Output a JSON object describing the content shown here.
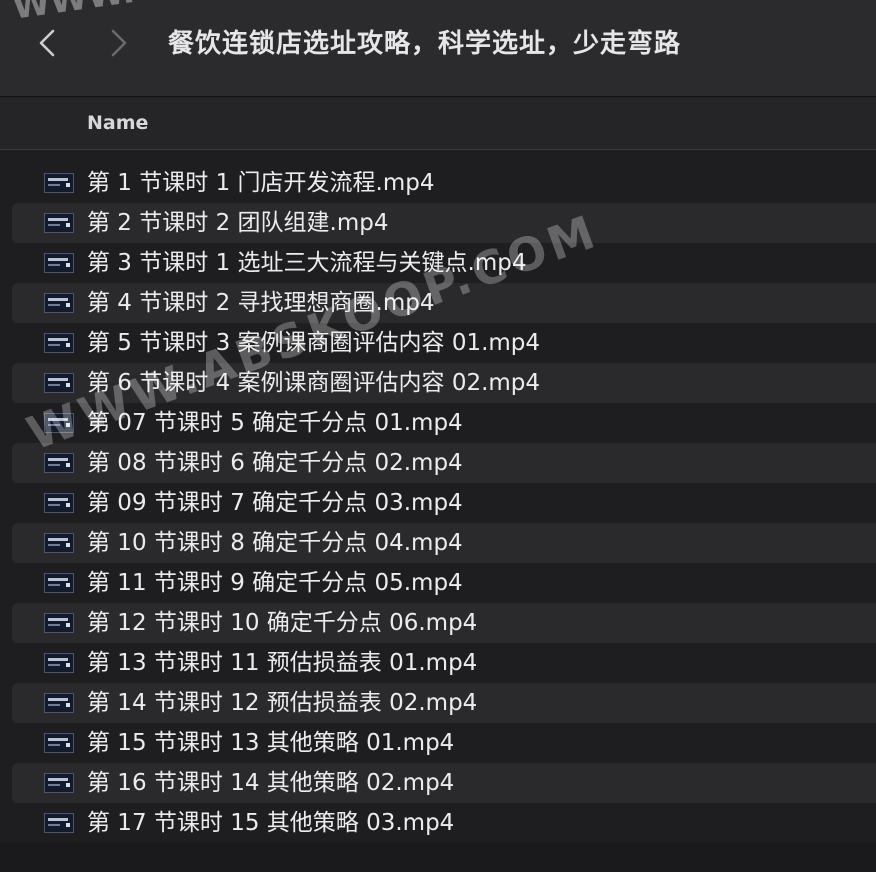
{
  "window": {
    "title": "餐饮连锁店选址攻略，科学选址，少走弯路",
    "back_icon": "chevron-left-icon",
    "forward_icon": "chevron-right-icon"
  },
  "header": {
    "name_label": "Name"
  },
  "files": [
    {
      "name": "第 1 节课时 1 门店开发流程.mp4"
    },
    {
      "name": "第 2 节课时 2 团队组建.mp4"
    },
    {
      "name": "第 3 节课时 1 选址三大流程与关键点.mp4"
    },
    {
      "name": "第 4 节课时 2 寻找理想商圈.mp4"
    },
    {
      "name": "第 5 节课时 3 案例课商圈评估内容 01.mp4"
    },
    {
      "name": "第 6 节课时 4 案例课商圈评估内容 02.mp4"
    },
    {
      "name": "第 07 节课时 5 确定千分点 01.mp4"
    },
    {
      "name": "第 08 节课时 6 确定千分点 02.mp4"
    },
    {
      "name": "第 09 节课时 7 确定千分点 03.mp4"
    },
    {
      "name": "第 10 节课时 8 确定千分点 04.mp4"
    },
    {
      "name": "第 11 节课时 9 确定千分点 05.mp4"
    },
    {
      "name": "第 12 节课时 10 确定千分点 06.mp4"
    },
    {
      "name": "第 13 节课时 11 预估损益表 01.mp4"
    },
    {
      "name": "第 14 节课时 12 预估损益表 02.mp4"
    },
    {
      "name": "第 15 节课时 13 其他策略 01.mp4"
    },
    {
      "name": "第 16 节课时 14 其他策略 02.mp4"
    },
    {
      "name": "第 17 节课时 15 其他策略 03.mp4"
    }
  ],
  "watermark": {
    "top_text": "WWW.",
    "mid_text": "WWW.ABSKOOP.COM"
  },
  "colors": {
    "background": "#1e1e20",
    "titlebar": "#2b2b2e",
    "row_alt": "#2a2a2d",
    "text": "#ececee"
  }
}
